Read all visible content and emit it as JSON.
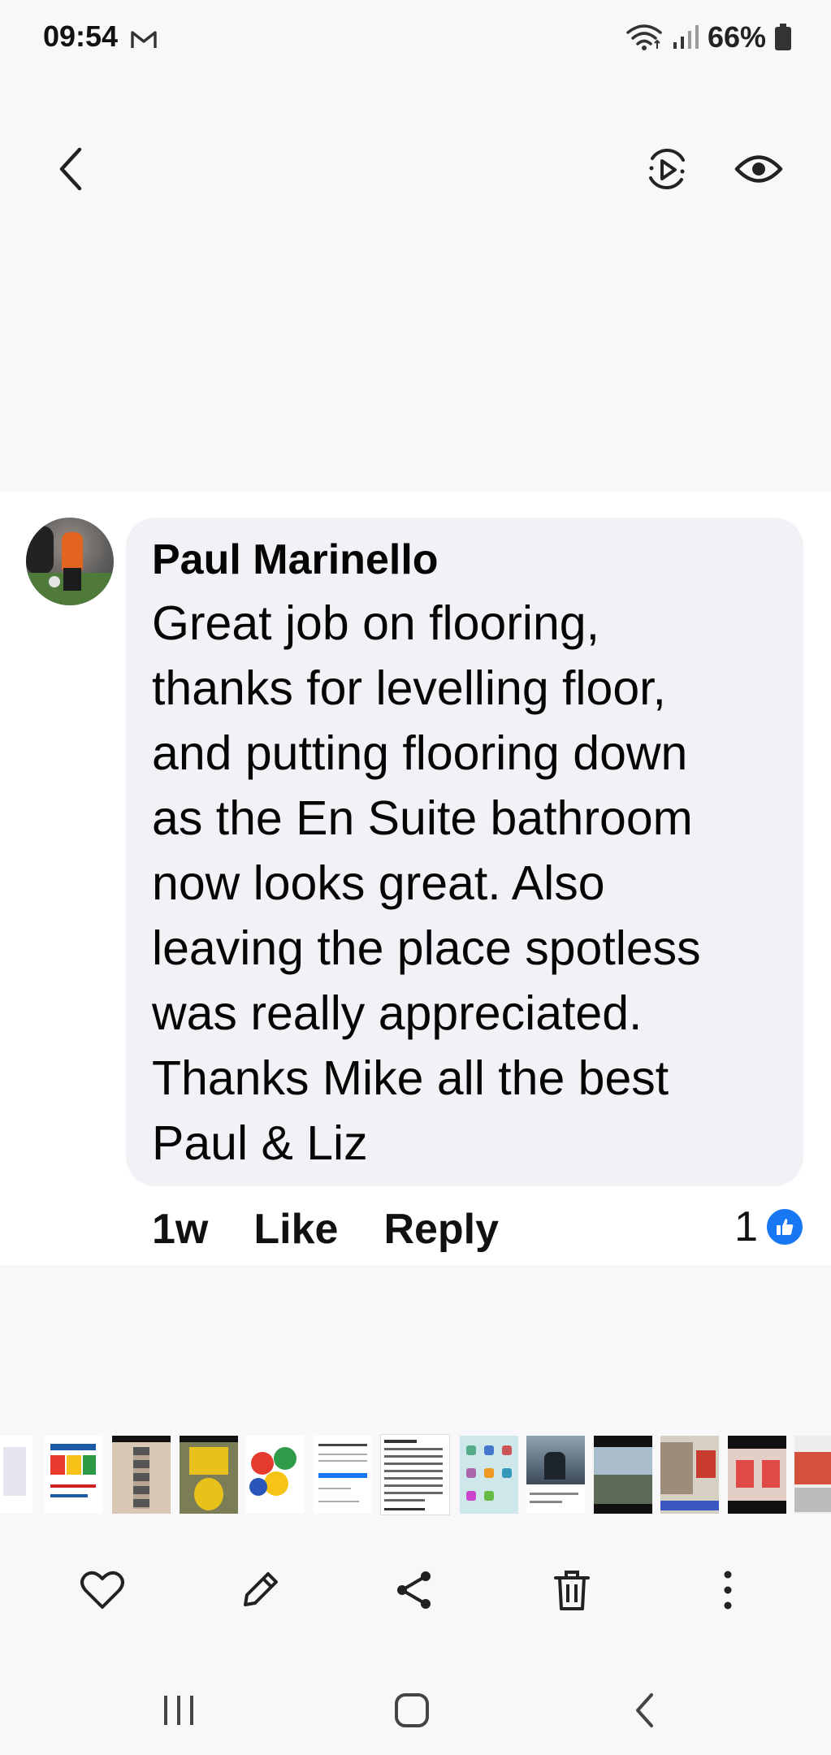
{
  "status_bar": {
    "time": "09:54",
    "battery": "66%",
    "icons": [
      "gmail-icon",
      "wifi-icon",
      "signal-icon",
      "battery-icon"
    ]
  },
  "viewer": {
    "top_icons": [
      "back-icon",
      "motion-photo-icon",
      "eye-icon"
    ]
  },
  "comment": {
    "author": "Paul Marinello",
    "text": "Great job on flooring,\nthanks for levelling floor,\nand putting flooring down\nas the En Suite bathroom\nnow looks great. Also\nleaving the place spotless\nwas really appreciated.\nThanks Mike all the best\nPaul & Liz",
    "time": "1w",
    "like_label": "Like",
    "reply_label": "Reply",
    "reaction_count": "1"
  },
  "colors": {
    "accent": "#1877f2",
    "bubble": "#f0f2f5",
    "background": "#f8f8fa"
  },
  "bottom_toolbar": {
    "icons": [
      "heart-icon",
      "edit-pencil-icon",
      "share-icon",
      "trash-icon",
      "more-vertical-icon"
    ]
  },
  "nav_bar": {
    "icons": [
      "recent-apps-icon",
      "home-icon",
      "back-nav-icon"
    ]
  }
}
